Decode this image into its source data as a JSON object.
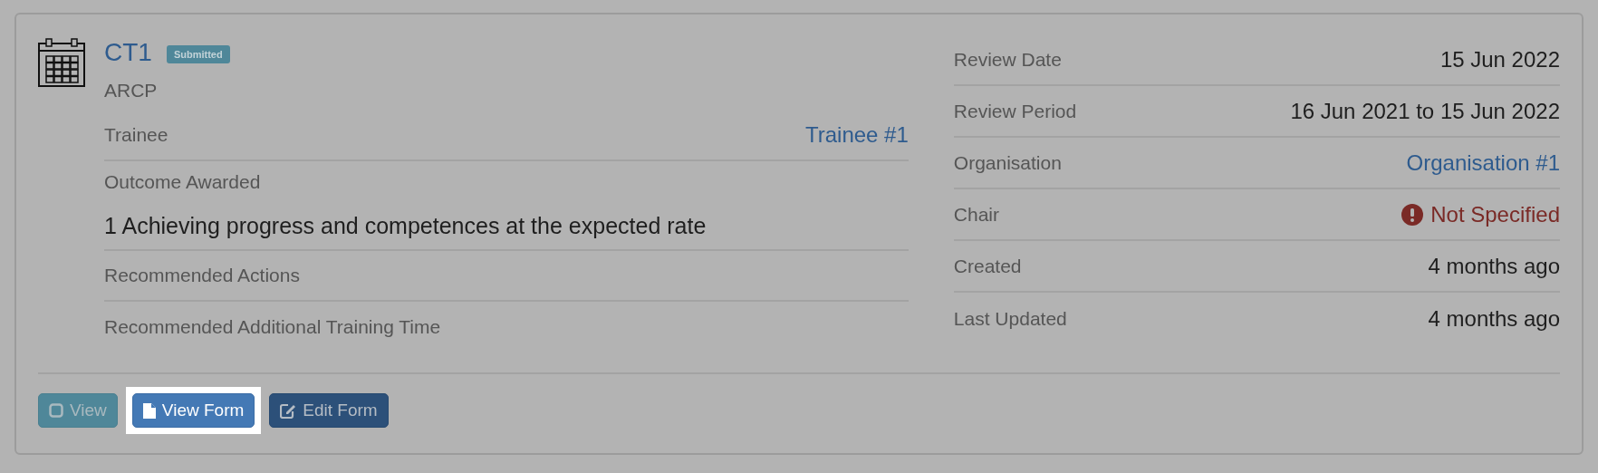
{
  "card": {
    "title": "CT1",
    "badge": "Submitted",
    "subtitle": "ARCP",
    "details": [
      {
        "kind": "link",
        "label": "Trainee",
        "value": "Trainee #1"
      },
      {
        "kind": "block",
        "label": "Outcome Awarded",
        "value": "1 Achieving progress and competences at the expected rate"
      },
      {
        "kind": "empty",
        "label": "Recommended Actions"
      },
      {
        "kind": "empty",
        "label": "Recommended Additional Training Time"
      }
    ],
    "facts": [
      {
        "kind": "text",
        "label": "Review Date",
        "value": "15 Jun 2022"
      },
      {
        "kind": "text",
        "label": "Review Period",
        "value": "16 Jun 2021 to 15 Jun 2022"
      },
      {
        "kind": "link",
        "label": "Organisation",
        "value": "Organisation #1"
      },
      {
        "kind": "warning",
        "label": "Chair",
        "value": "Not Specified"
      },
      {
        "kind": "text",
        "label": "Created",
        "value": "4 months ago"
      },
      {
        "kind": "text",
        "label": "Last Updated",
        "value": "4 months ago"
      }
    ],
    "buttons": [
      {
        "kind": "view",
        "label": "View",
        "highlighted": false
      },
      {
        "kind": "form",
        "label": "View Form",
        "highlighted": true
      },
      {
        "kind": "edit",
        "label": "Edit Form",
        "highlighted": false
      }
    ]
  }
}
